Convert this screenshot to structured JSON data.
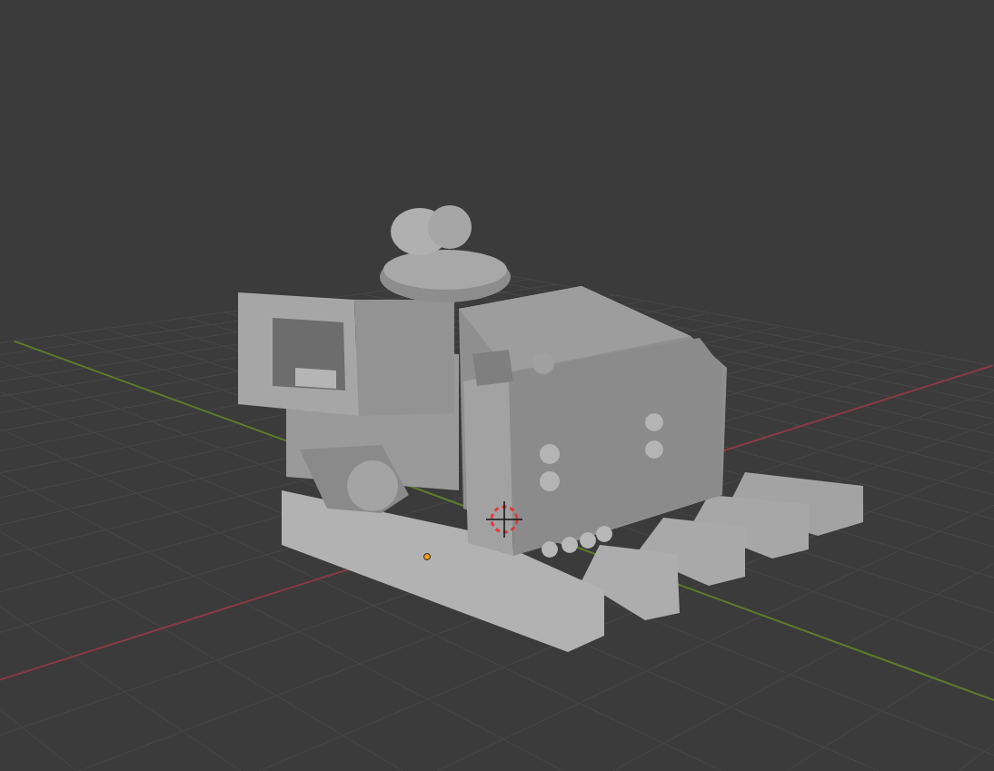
{
  "viewport": {
    "grid": true,
    "x_axis": true,
    "y_axis": true,
    "cursor": true,
    "origin": true
  }
}
